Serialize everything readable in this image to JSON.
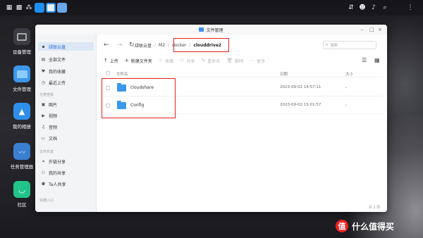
{
  "topbar": {
    "icons": [
      "grid-icon",
      "apps-icon",
      "share-icon",
      "camera-app-icon",
      "window-app-icon",
      "file-app-icon",
      "network-icon",
      "user-icon",
      "notification-icon",
      "search-icon",
      "settings-icon"
    ]
  },
  "dock": {
    "items": [
      {
        "label": "设备管理",
        "icon": "device-icon",
        "color": "#3b3b44"
      },
      {
        "label": "文件管理",
        "icon": "folder-icon",
        "color": "#3c98ea"
      },
      {
        "label": "我的相册",
        "icon": "photo-icon",
        "color": "#2f8fe8"
      },
      {
        "label": "任务管理器",
        "icon": "chart-icon",
        "color": "#3a7fd0"
      },
      {
        "label": "社区",
        "icon": "community-icon",
        "color": "#22c48a"
      }
    ]
  },
  "window": {
    "title": "文件管理"
  },
  "sidebar": {
    "items": [
      {
        "label": "绿联云盘",
        "icon": "cloud-disk-icon",
        "glyph": "▪"
      },
      {
        "label": "全部文件",
        "icon": "all-files-icon",
        "glyph": "▤"
      },
      {
        "label": "我的收藏",
        "icon": "heart-icon",
        "glyph": "♥"
      },
      {
        "label": "最近上传",
        "icon": "clock-icon",
        "glyph": "◷"
      },
      {
        "label": "图片",
        "icon": "image-icon",
        "glyph": "▣"
      },
      {
        "label": "视频",
        "icon": "video-icon",
        "glyph": "▶"
      },
      {
        "label": "音频",
        "icon": "audio-icon",
        "glyph": "♫"
      },
      {
        "label": "文档",
        "icon": "document-icon",
        "glyph": "▭"
      },
      {
        "label": "外链分享",
        "icon": "link-share-icon",
        "glyph": "⚭"
      },
      {
        "label": "我的共享",
        "icon": "my-share-icon",
        "glyph": "⚇"
      },
      {
        "label": "Ta人共享",
        "icon": "others-share-icon",
        "glyph": "⚉"
      }
    ],
    "sections": [
      "分类查看",
      "文件共享",
      "快捷入口"
    ]
  },
  "nav": {
    "back": "←",
    "forward": "→",
    "refresh": "↻"
  },
  "breadcrumb": {
    "items": [
      "绿联云盘",
      "M2",
      "docker",
      "clouddrive2"
    ],
    "sep": "/"
  },
  "search": {
    "placeholder": "搜索"
  },
  "toolbar": {
    "items": [
      {
        "label": "上传",
        "glyph": "↑",
        "enabled": true
      },
      {
        "label": "新建文件夹",
        "glyph": "+",
        "enabled": true
      },
      {
        "label": "收藏",
        "glyph": "☆",
        "enabled": false
      },
      {
        "label": "共享",
        "glyph": "⚇",
        "enabled": false
      },
      {
        "label": "重命名",
        "glyph": "✎",
        "enabled": false
      },
      {
        "label": "删除",
        "glyph": "🗑",
        "enabled": false
      },
      {
        "label": "更多",
        "glyph": "⋯",
        "enabled": false
      }
    ]
  },
  "table": {
    "headers": {
      "name": "文件名",
      "date": "日期",
      "size": "大小"
    },
    "rows": [
      {
        "name": "cloudshare",
        "date": "2023-09-02 14:57:11",
        "size": "-"
      },
      {
        "name": "Config",
        "date": "2023-09-02 15:01:57",
        "size": "-"
      }
    ]
  },
  "status": {
    "count": "共 2 项"
  },
  "watermark": {
    "badge": "值",
    "text": "什么值得买"
  }
}
